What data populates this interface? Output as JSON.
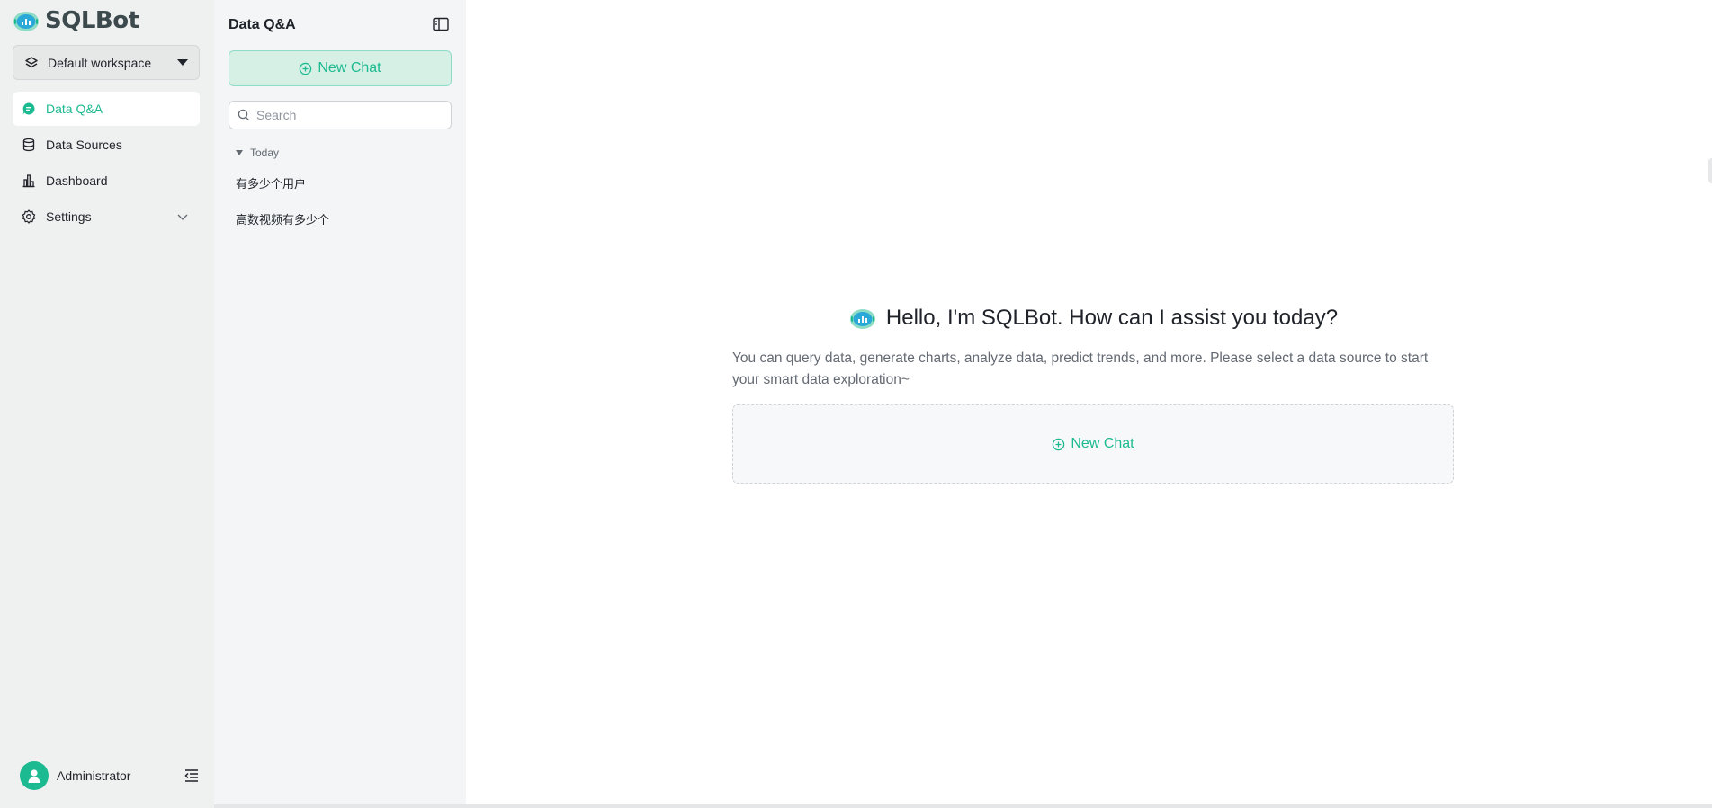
{
  "app": {
    "name": "SQLBot"
  },
  "workspace": {
    "label": "Default workspace"
  },
  "nav": {
    "items": [
      {
        "label": "Data Q&A",
        "icon": "chat-bubble-icon",
        "active": true
      },
      {
        "label": "Data Sources",
        "icon": "database-icon",
        "active": false
      },
      {
        "label": "Dashboard",
        "icon": "bar-chart-icon",
        "active": false
      },
      {
        "label": "Settings",
        "icon": "gear-icon",
        "active": false,
        "expandable": true
      }
    ]
  },
  "user": {
    "name": "Administrator"
  },
  "chat_panel": {
    "title": "Data Q&A",
    "new_chat_label": "New Chat",
    "search_placeholder": "Search",
    "groups": [
      {
        "label": "Today",
        "conversations": [
          "有多少个用户",
          "高数视频有多少个"
        ]
      }
    ]
  },
  "main": {
    "welcome_title": "Hello, I'm SQLBot. How can I assist you today?",
    "description": "You can query data, generate charts, analyze data, predict trends, and more. Please select a data source to start your smart data exploration~",
    "new_chat_label": "New Chat"
  },
  "colors": {
    "accent": "#1cba90",
    "nav_bg": "#eff1f0",
    "panel_bg": "#f3f5f6",
    "main_bg": "#ffffff",
    "text": "#1f2329",
    "muted_text": "#646a73"
  }
}
